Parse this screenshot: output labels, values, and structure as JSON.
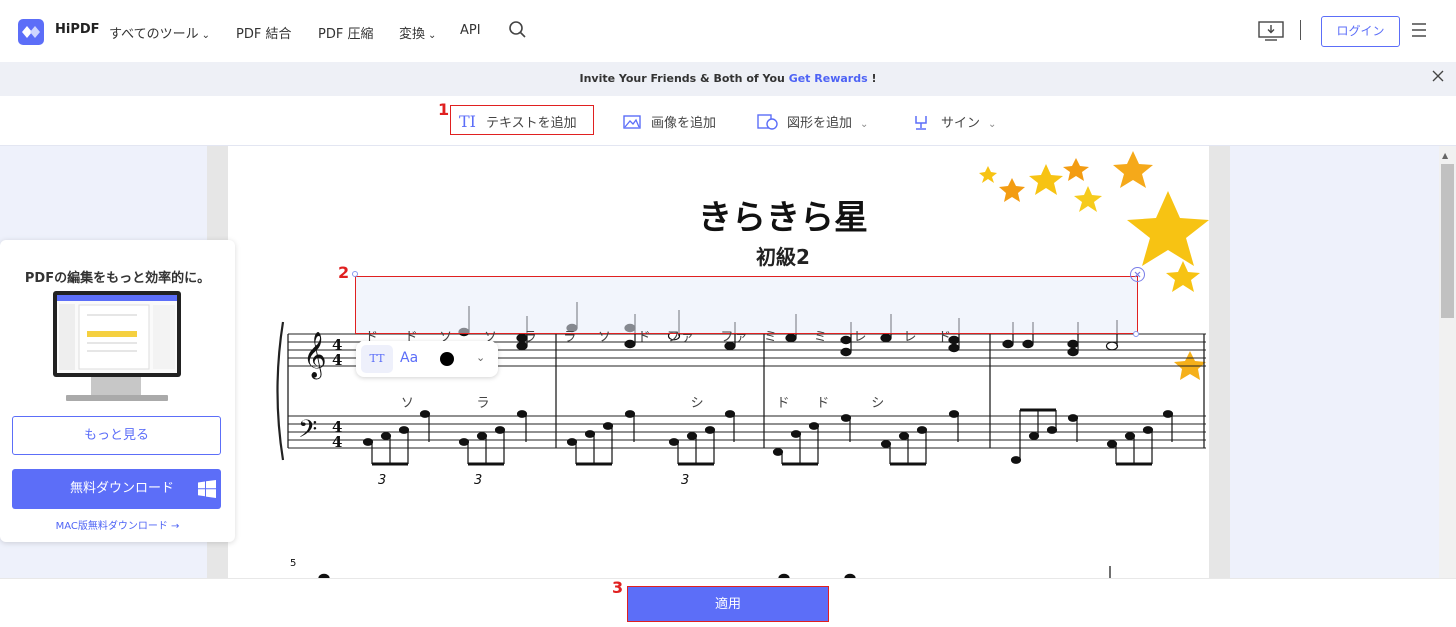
{
  "header": {
    "logo_text": "HiPDF",
    "nav": {
      "all_tools": "すべてのツール",
      "merge": "PDF 結合",
      "compress": "PDF 圧縮",
      "convert": "変換",
      "api": "API"
    },
    "login_label": "ログイン"
  },
  "banner": {
    "prefix": "Invite Your Friends & Both of You ",
    "link": "Get Rewards",
    "suffix": " !"
  },
  "toolbar": {
    "add_text": "テキストを追加",
    "add_text_icon": "TI",
    "add_image": "画像を追加",
    "add_shape": "図形を追加",
    "sign": "サイン"
  },
  "annotations": {
    "step1": "1",
    "step2": "2",
    "step3": "3"
  },
  "promo": {
    "title": "PDFの編集をもっと効率的に。",
    "more_label": "もっと見る",
    "download_label": "無料ダウンロード",
    "mac_link": "MAC版無料ダウンロード →"
  },
  "sheet": {
    "title": "きらきら星",
    "subtitle": "初級2",
    "measure_number": "5",
    "triplet_marks": [
      "3",
      "3",
      "3"
    ],
    "textbox_line1": "ド     ド    ソ      ソ     ラ     ラ    ソ     ド   ファ     ファ   ミ       ミ     レ       レ    ド",
    "textbox_line2": "       ソ            ラ                                       シ              ド     ド        シ"
  },
  "format_bar": {
    "tt_label": "TT",
    "aa_label": "Aa",
    "color": "#000000"
  },
  "footer": {
    "apply_label": "適用"
  },
  "colors": {
    "accent": "#5c6ef8",
    "highlight_box": "#e02020"
  }
}
